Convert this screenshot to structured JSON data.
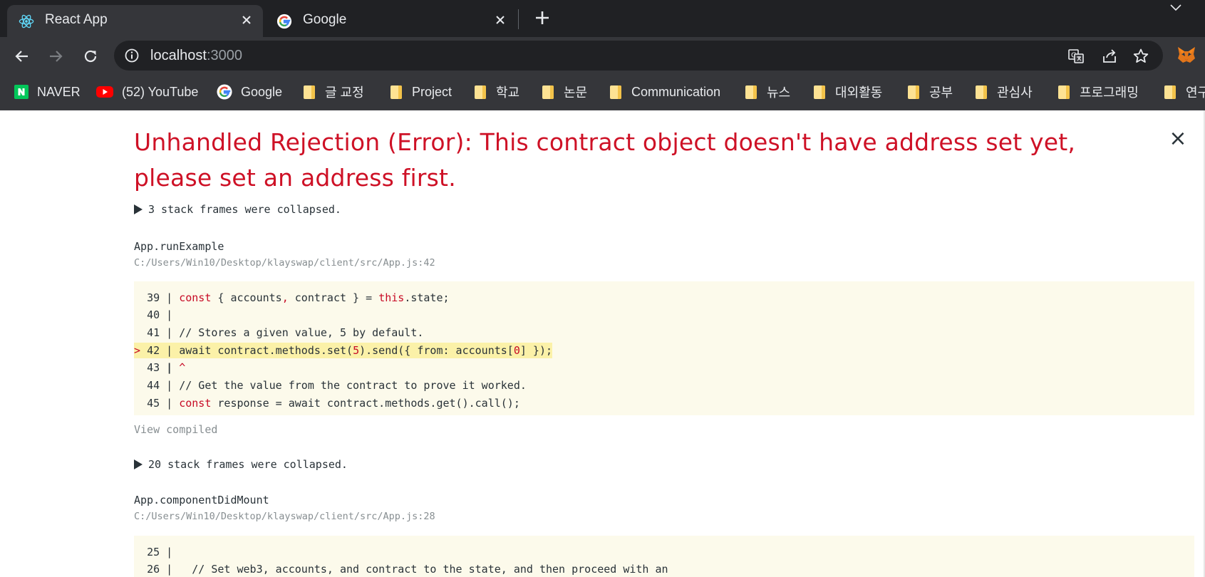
{
  "tabs": [
    {
      "title": "React App",
      "icon": "react-logo-icon",
      "active": true
    },
    {
      "title": "Google",
      "icon": "google-logo-icon",
      "active": false
    }
  ],
  "address_bar": {
    "host": "localhost",
    "port": ":3000"
  },
  "bookmarks": [
    {
      "label": "NAVER",
      "icon": "naver-icon"
    },
    {
      "label": "(52) YouTube",
      "icon": "youtube-icon"
    },
    {
      "label": "Google",
      "icon": "google-logo-icon"
    },
    {
      "label": "글 교정",
      "icon": "folder-icon"
    },
    {
      "label": "Project",
      "icon": "folder-icon"
    },
    {
      "label": "학교",
      "icon": "folder-icon"
    },
    {
      "label": "논문",
      "icon": "folder-icon"
    },
    {
      "label": "Communication",
      "icon": "folder-icon"
    },
    {
      "label": "뉴스",
      "icon": "folder-icon"
    },
    {
      "label": "대외활동",
      "icon": "folder-icon"
    },
    {
      "label": "공부",
      "icon": "folder-icon"
    },
    {
      "label": "관심사",
      "icon": "folder-icon"
    },
    {
      "label": "프로그래밍",
      "icon": "folder-icon"
    },
    {
      "label": "연구",
      "icon": "folder-icon"
    }
  ],
  "overlay": {
    "title": "Unhandled Rejection (Error): This contract object doesn't have address set yet, please set an address first.",
    "close_glyph": "×",
    "collapsed_1": "3 stack frames were collapsed.",
    "frame_1": {
      "name": "App.runExample",
      "path": "C:/Users/Win10/Desktop/klayswap/client/src/App.js:42"
    },
    "code_1": [
      {
        "marker": "  ",
        "num": "39",
        "highlight": false
      },
      {
        "marker": "  ",
        "num": "40",
        "highlight": false
      },
      {
        "marker": "  ",
        "num": "41",
        "highlight": false
      },
      {
        "marker": "> ",
        "num": "42",
        "highlight": true
      },
      {
        "marker": "  ",
        "num": "43",
        "highlight": false
      },
      {
        "marker": "  ",
        "num": "44",
        "highlight": false
      },
      {
        "marker": "  ",
        "num": "45",
        "highlight": false
      }
    ],
    "code_1_text": {
      "l39_kw1": "const",
      "l39_rest1": " { accounts",
      "l39_comma": ",",
      "l39_rest2": " contract } = ",
      "l39_kw2": "this",
      "l39_rest3": ".state;",
      "l41": "// Stores a given value, 5 by default.",
      "l42_a": "await contract.methods.set(",
      "l42_num": "5",
      "l42_b": ").send({ from: accounts[",
      "l42_idx": "0",
      "l42_c": "] });",
      "l43": "^",
      "l44": "// Get the value from the contract to prove it worked.",
      "l45_kw": "const",
      "l45_rest": " response = await contract.methods.get().call();"
    },
    "view_compiled": "View compiled",
    "collapsed_2": "20 stack frames were collapsed.",
    "frame_2": {
      "name": "App.componentDidMount",
      "path": "C:/Users/Win10/Desktop/klayswap/client/src/App.js:28"
    },
    "code_2": [
      {
        "num": "25"
      },
      {
        "num": "26"
      }
    ],
    "code_2_text": {
      "l26": "  // Set web3, accounts, and contract to the state, and then proceed with an"
    }
  },
  "colors": {
    "error_red": "#ce1126",
    "code_background": "#fcfaeb",
    "highlight_line": "#fbf1a8",
    "chrome_dark": "#202124",
    "chrome_toolbar": "#35363a"
  }
}
